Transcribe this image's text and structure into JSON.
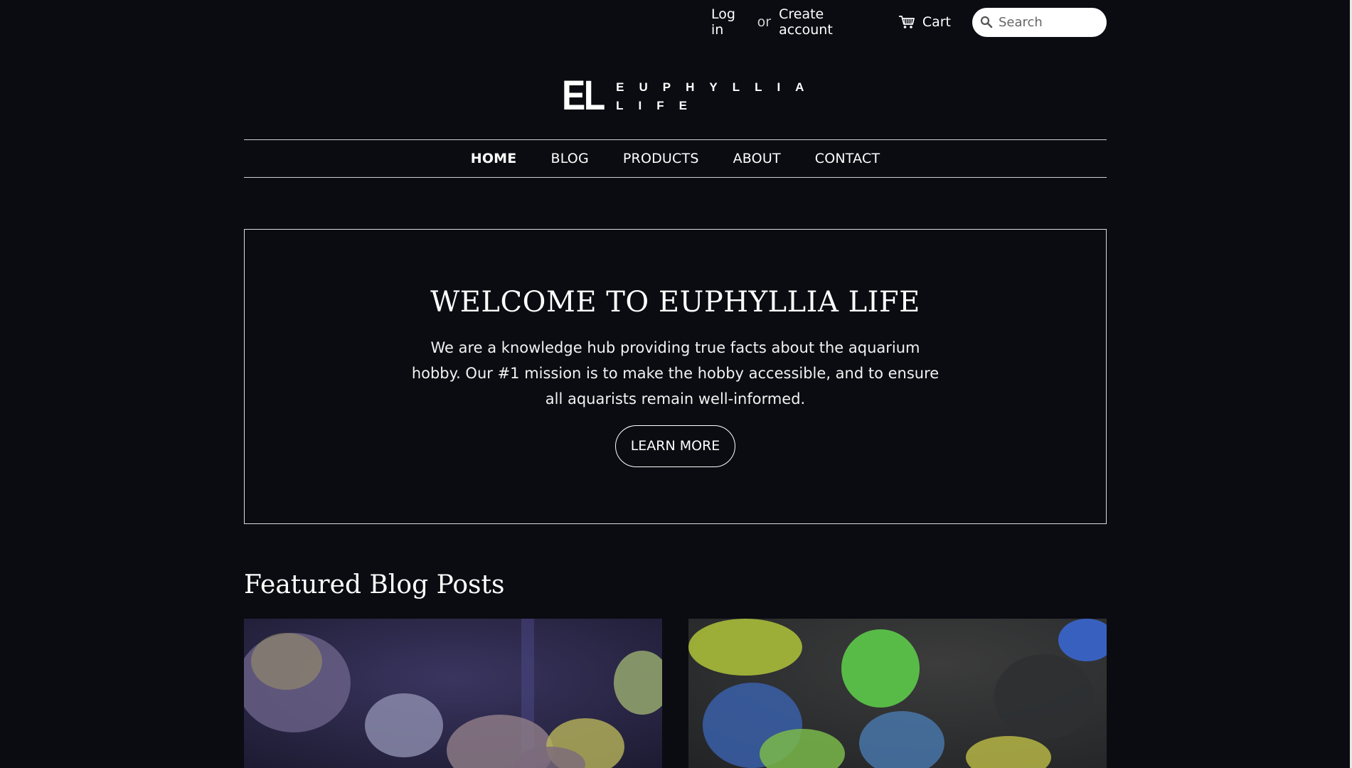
{
  "header": {
    "login_label": "Log in",
    "or_label": "or",
    "create_account_label": "Create account",
    "cart_label": "Cart",
    "cart_icon": "cart-icon",
    "search_icon": "search-icon",
    "search_placeholder": "Search"
  },
  "logo": {
    "mark": "EL",
    "line1": "EUPHYLLIA",
    "line2": "LIFE"
  },
  "nav": {
    "items": [
      {
        "label": "HOME",
        "active": true
      },
      {
        "label": "BLOG",
        "active": false
      },
      {
        "label": "PRODUCTS",
        "active": false
      },
      {
        "label": "ABOUT",
        "active": false
      },
      {
        "label": "CONTACT",
        "active": false
      }
    ]
  },
  "hero": {
    "title": "WELCOME TO EUPHYLLIA LIFE",
    "body": "We are a knowledge hub providing true facts about the aquarium hobby. Our #1 mission is to make the hobby accessible, and to ensure all aquarists remain well-informed.",
    "button_label": "LEARN MORE"
  },
  "featured": {
    "title": "Featured Blog Posts"
  },
  "colors": {
    "background": "#0a0c11",
    "text": "#ffffff",
    "border": "#dcdcdc"
  }
}
